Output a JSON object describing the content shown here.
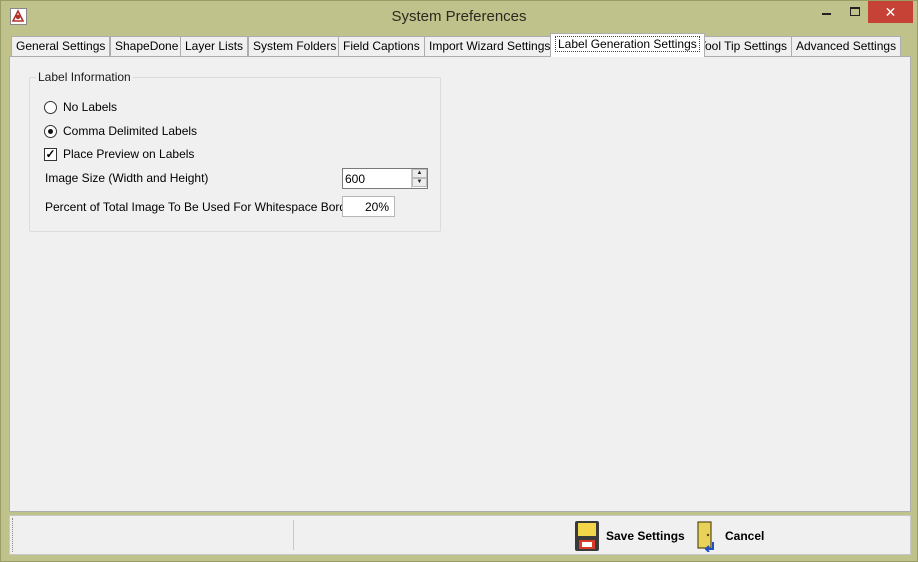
{
  "window": {
    "title": "System Preferences",
    "close_glyph": "✕"
  },
  "tabs": [
    {
      "label": "General Settings",
      "active": false
    },
    {
      "label": "ShapeDone",
      "active": false
    },
    {
      "label": "Layer Lists",
      "active": false
    },
    {
      "label": "System Folders",
      "active": false
    },
    {
      "label": "Field Captions",
      "active": false
    },
    {
      "label": "Import Wizard Settings",
      "active": false
    },
    {
      "label": "Label Generation Settings",
      "active": true
    },
    {
      "label": "Tool Tip Settings",
      "active": false
    },
    {
      "label": "Advanced Settings",
      "active": false
    }
  ],
  "label_info": {
    "group_title": "Label Information",
    "no_labels": {
      "label": "No Labels",
      "checked": false
    },
    "comma_delimited": {
      "label": "Comma Delimited Labels",
      "checked": true
    },
    "place_preview": {
      "label": "Place Preview on Labels",
      "checked": true,
      "glyph": "✓"
    },
    "image_size": {
      "label": "Image Size (Width and Height)",
      "value": "600"
    },
    "whitespace": {
      "label": "Percent of Total Image To Be Used For Whitespace Border",
      "value": "20%"
    }
  },
  "footer": {
    "save_label": "Save Settings",
    "cancel_label": "Cancel"
  },
  "icons": {
    "app": "app-logo-icon",
    "save": "floppy-disk-icon",
    "cancel": "exit-door-icon"
  },
  "colors": {
    "frame": "#bfc28a",
    "close_button": "#c74236",
    "panel": "#f0f0f0"
  }
}
